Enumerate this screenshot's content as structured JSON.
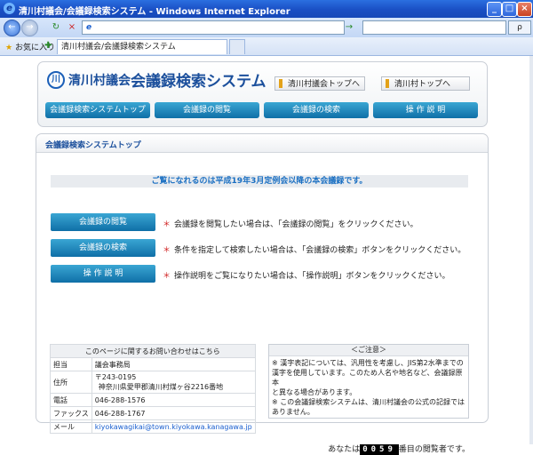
{
  "window": {
    "title": "清川村議会/会議録検索システム - Windows Internet Explorer",
    "min_label": "_",
    "max_label": "□",
    "close_label": "×"
  },
  "toolbar": {
    "back": "←",
    "forward": "→",
    "refresh": "↻",
    "stop": "×",
    "address_value": "e",
    "go": "→",
    "search_label": "ρ"
  },
  "favbar": {
    "favorites_label": "お気に入り",
    "tab_label": "清川村議会/会議録検索システム"
  },
  "header": {
    "logo_org": "清川村議会",
    "logo_system": "会議録検索システム",
    "links": [
      "清川村議会トップへ",
      "清川村トップへ"
    ],
    "menu": [
      "会議録検索システムトップ",
      "会議録の閲覧",
      "会議録の検索",
      "操 作 説 明"
    ]
  },
  "main": {
    "heading": "会議録検索システムトップ",
    "notice": "ご覧になれるのは平成19年3月定例会以降の本会議録です。",
    "actions": [
      {
        "button": "会議録の閲覧",
        "desc": "会議録を閲覧したい場合は、「会議録の閲覧」をクリックください。"
      },
      {
        "button": "会議録の検索",
        "desc": "条件を指定して検索したい場合は、「会議録の検索」ボタンをクリックください。"
      },
      {
        "button": "操 作 説 明",
        "desc": "操作説明をご覧になりたい場合は、「操作説明」ボタンをクリックください。"
      }
    ],
    "bullet": "＊"
  },
  "contact": {
    "title": "このページに関するお問い合わせはこちら",
    "rows": [
      {
        "label": "担当",
        "value": "議会事務局"
      },
      {
        "label": "住所",
        "value": "〒243-0195",
        "value2": "神奈川県愛甲郡清川村煤ヶ谷2216番地"
      },
      {
        "label": "電話",
        "value": "046-288-1576"
      },
      {
        "label": "ファックス",
        "value": "046-288-1767"
      },
      {
        "label": "メール",
        "value": "kiyokawagikai@town.kiyokawa.kanagawa.jp"
      }
    ]
  },
  "caution": {
    "title": "＜ご注意＞",
    "lines": [
      "※ 漢字表記については、汎用性を考慮し、JIS第2水準までの",
      "漢字を使用しています。このため人名や地名など、会議録原本",
      "と異なる場合があります。",
      "※ この会議録検索システムは、清川村議会の公式の記録では",
      "ありません。"
    ]
  },
  "counter": {
    "prefix": "あなたは",
    "digits": "0059",
    "suffix": "番目の閲覧者です。"
  }
}
